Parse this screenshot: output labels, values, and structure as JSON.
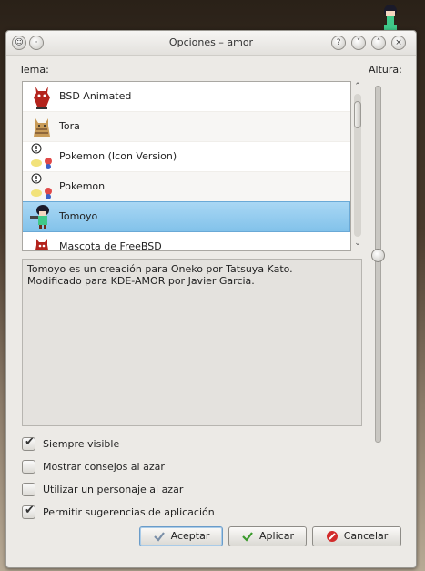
{
  "window": {
    "title": "Opciones – amor"
  },
  "labels": {
    "tema": "Tema:",
    "altura": "Altura:"
  },
  "themes": [
    {
      "name": "BSD Animated",
      "icon": "bsd-daemon-icon"
    },
    {
      "name": "Tora",
      "icon": "tora-cat-icon"
    },
    {
      "name": "Pokemon (Icon Version)",
      "icon": "pokemon-icon"
    },
    {
      "name": "Pokemon",
      "icon": "pokemon-icon"
    },
    {
      "name": "Tomoyo",
      "icon": "tomoyo-icon",
      "selected": true
    },
    {
      "name": "Mascota de FreeBSD",
      "icon": "freebsd-mascot-icon"
    }
  ],
  "altura_fraction": 0.56,
  "description": {
    "line1": "Tomoyo es un creación para Oneko por Tatsuya Kato.",
    "line2": "Modificado para KDE-AMOR por Javier Garcia."
  },
  "options": [
    {
      "label": "Siempre visible",
      "checked": true
    },
    {
      "label": "Mostrar consejos al azar",
      "checked": false
    },
    {
      "label": "Utilizar un personaje al azar",
      "checked": false
    },
    {
      "label": "Permitir sugerencias de aplicación",
      "checked": true
    }
  ],
  "buttons": {
    "accept": "Aceptar",
    "apply": "Aplicar",
    "cancel": "Cancelar"
  },
  "colors": {
    "selection": "#82c2ea",
    "accent_border": "#6aa9d6"
  }
}
